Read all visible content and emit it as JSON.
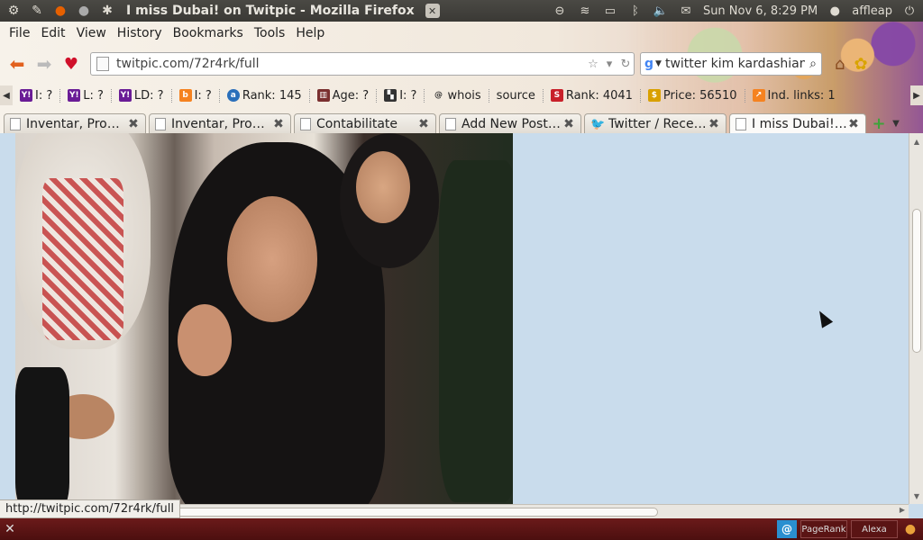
{
  "top_panel": {
    "window_title": "I miss Dubai! on Twitpic - Mozilla Firefox",
    "clock": "Sun Nov  6,  8:29 PM",
    "user": "affleap"
  },
  "menubar": [
    "File",
    "Edit",
    "View",
    "History",
    "Bookmarks",
    "Tools",
    "Help"
  ],
  "navbar": {
    "url": "twitpic.com/72r4rk/full",
    "search_value": "twitter kim kardashian"
  },
  "seobar": [
    {
      "icon": "yahoo-icon",
      "text": "I: ?"
    },
    {
      "icon": "yahoo-icon",
      "text": "L: ?"
    },
    {
      "icon": "yahoo-icon",
      "text": "LD: ?"
    },
    {
      "icon": "bing-icon",
      "text": "I: ?"
    },
    {
      "icon": "alexa-icon",
      "text": "Rank: 145"
    },
    {
      "icon": "archive-icon",
      "text": "Age: ?"
    },
    {
      "icon": "delicious-icon",
      "text": "I: ?"
    },
    {
      "icon": "fingerprint-icon",
      "text": "whois"
    },
    {
      "icon": "",
      "text": "source"
    },
    {
      "icon": "rank-icon",
      "text": "Rank: 4041"
    },
    {
      "icon": "price-icon",
      "text": "Price: 56510"
    },
    {
      "icon": "links-icon",
      "text": "Ind. links: 1"
    }
  ],
  "tabs": [
    {
      "label": "Inventar, Profil...",
      "active": false,
      "icon": "page-icon"
    },
    {
      "label": "Inventar, Profil...",
      "active": false,
      "icon": "page-icon"
    },
    {
      "label": "Contabilitate",
      "active": false,
      "icon": "page-icon"
    },
    {
      "label": "Add New Post ‹...",
      "active": false,
      "icon": "page-icon"
    },
    {
      "label": "Twitter / Recen...",
      "active": false,
      "icon": "twitter-icon"
    },
    {
      "label": "I miss Dubai! o...",
      "active": true,
      "icon": "page-icon"
    }
  ],
  "status_bar": {
    "link": "http://twitpic.com/72r4rk/full"
  },
  "bottom_panel": {
    "pagerank": "PageRank",
    "alexa": "Alexa"
  },
  "colors": {
    "page_background": "#c9dcec",
    "bottom_panel": "#5a1414",
    "top_panel": "#3c3b37"
  }
}
